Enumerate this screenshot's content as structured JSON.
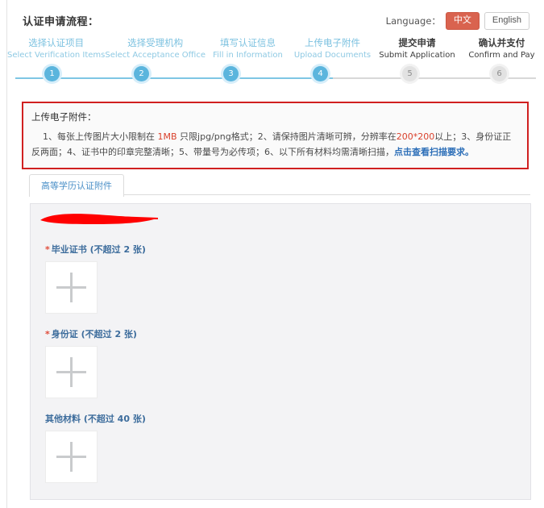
{
  "header": {
    "title": "认证申请流程：",
    "language_label": "Language：",
    "lang_cn": "中文",
    "lang_en": "English",
    "accent_color": "#d9634f"
  },
  "stepper": {
    "active_color": "#5bb5dd",
    "inactive_color": "#e2e2e2",
    "steps": [
      {
        "num": "1",
        "cn": "选择认证项目",
        "en": "Select Verification Items",
        "state": "active"
      },
      {
        "num": "2",
        "cn": "选择受理机构",
        "en": "Select Acceptance Office",
        "state": "active"
      },
      {
        "num": "3",
        "cn": "填写认证信息",
        "en": "Fill in Information",
        "state": "active"
      },
      {
        "num": "4",
        "cn": "上传电子附件",
        "en": "Upload Documents",
        "state": "active"
      },
      {
        "num": "5",
        "cn": "提交申请",
        "en": "Submit Application",
        "state": "inactive"
      },
      {
        "num": "6",
        "cn": "确认并支付",
        "en": "Confirm and Pay",
        "state": "inactive"
      }
    ]
  },
  "notice": {
    "border_color": "#d02020",
    "title": "上传电子附件：",
    "line1_a": "1、每张上传图片大小限制在 ",
    "line1_size": "1MB",
    "line1_b": " 只限jpg/png格式；2、请保持图片清晰可辨，分辨率在",
    "line1_res": "200*200",
    "line1_c": "以上；3、身份证正反两面；4、证书中的印章",
    "line2_a": "完整清晰；5、带量号为必传项；6、以下所有材料均需清晰扫描，",
    "line2_link": "点击查看扫描要求。"
  },
  "tabs": [
    {
      "label": "高等学历认证附件",
      "active": true
    }
  ],
  "panel": {
    "redaction_color": "#ff0000",
    "uploads": [
      {
        "label": "毕业证书 (不超过 2 张)",
        "required": true,
        "max": "2",
        "icon": "plus-icon"
      },
      {
        "label": "身份证 (不超过 2 张)",
        "required": true,
        "max": "2",
        "icon": "plus-icon"
      },
      {
        "label": "其他材料 (不超过 40 张)",
        "required": false,
        "max": "40",
        "icon": "plus-icon"
      }
    ]
  }
}
